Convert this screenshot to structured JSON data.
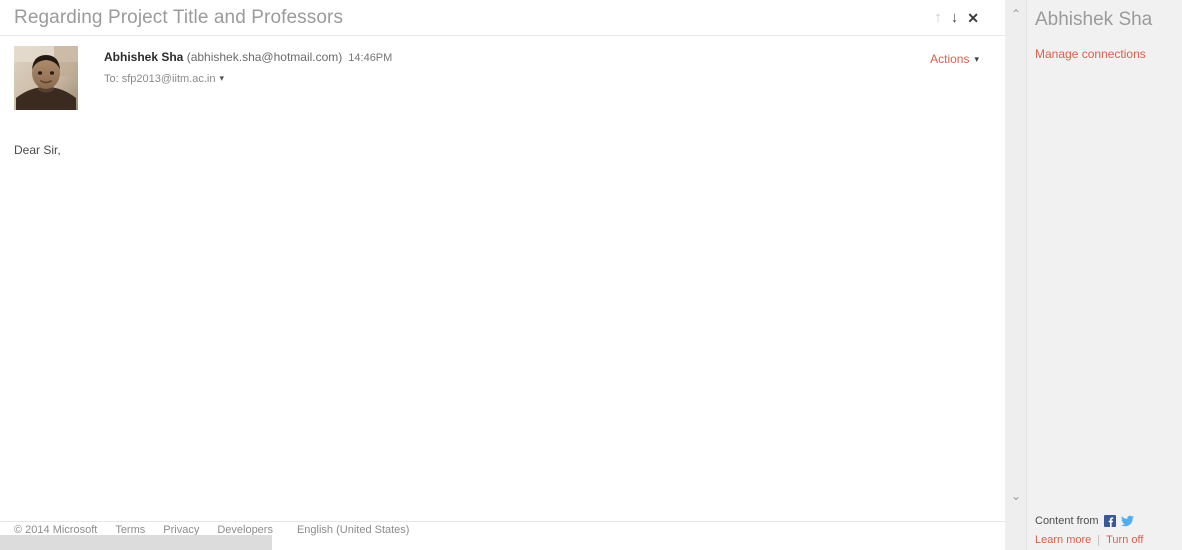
{
  "message": {
    "subject": "Regarding Project Title and Professors",
    "nav": {
      "previous_icon": "up-arrow-icon",
      "previous_glyph": "↑",
      "next_icon": "down-arrow-icon",
      "next_glyph": "↓",
      "close_icon": "close-icon",
      "close_glyph": "✕"
    },
    "sender": {
      "avatar_alt": "Abhishek Sha",
      "name": "Abhishek Sha",
      "email": "(abhishek.sha@hotmail.com)",
      "time": "14:46PM",
      "recipients_prefix": "To:",
      "recipients": "sfp2013@iitm.ac.in",
      "recipients_caret": "▾"
    },
    "actions": {
      "label": "Actions",
      "caret": "▾"
    },
    "body": "Dear Sir,"
  },
  "footer": {
    "links": [
      "© 2014 Microsoft",
      "Terms",
      "Privacy",
      "Developers"
    ],
    "language": "English (United States)"
  },
  "rail": {
    "expand_up_icon": "chevron-up-icon",
    "expand_up_glyph": "⌃",
    "collapse_down_icon": "chevron-down-icon",
    "collapse_down_glyph": "⌄"
  },
  "people_pane": {
    "title": "Abhishek Sha",
    "manage_connections": "Manage connections",
    "content_from_label": "Content from",
    "sources": [
      "facebook-icon",
      "twitter-icon"
    ],
    "learn_more": "Learn more",
    "separator": "|",
    "turn_off": "Turn off"
  },
  "colors": {
    "accent_link": "#d9604f",
    "subject_text": "#9b9b9b",
    "pane_background": "#f1f1f1",
    "rail_background": "#eeeeee",
    "facebook_blue": "#3b5998",
    "twitter_blue": "#55acee"
  }
}
